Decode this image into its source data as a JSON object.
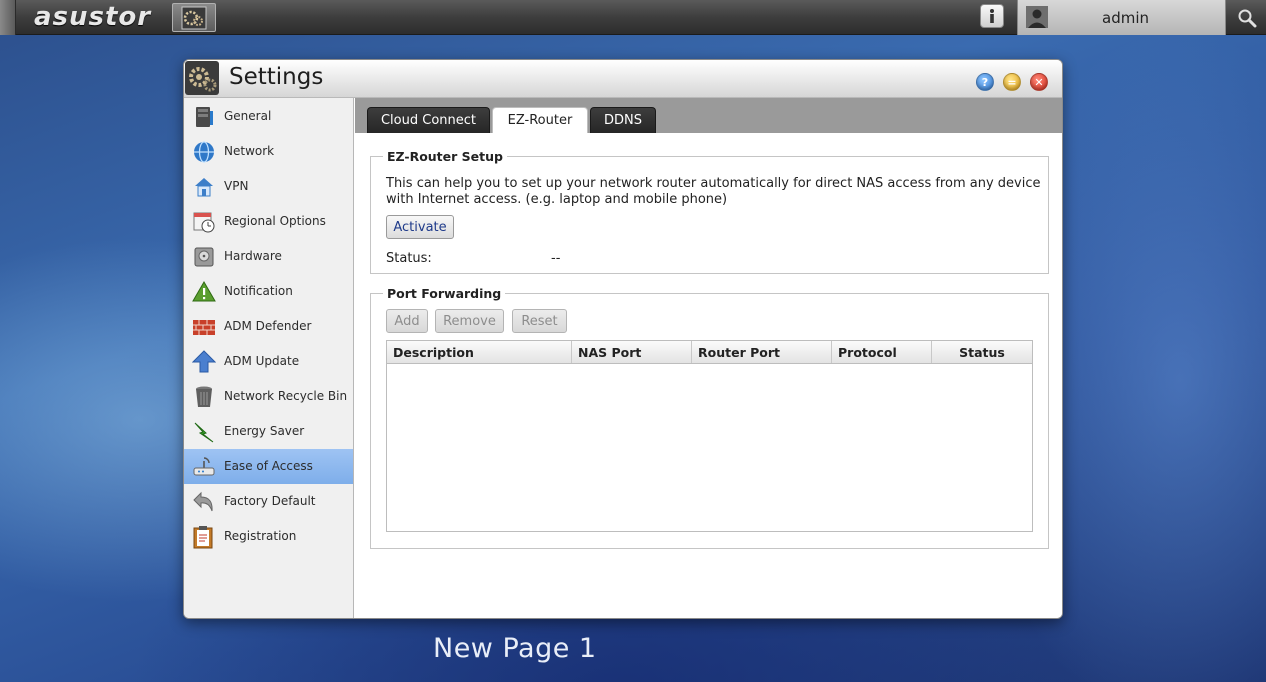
{
  "taskbar": {
    "brand": "asustor",
    "user": "admin"
  },
  "window": {
    "title": "Settings"
  },
  "sidebar": {
    "items": [
      {
        "label": "General",
        "icon": "server-icon"
      },
      {
        "label": "Network",
        "icon": "globe-icon"
      },
      {
        "label": "VPN",
        "icon": "vpn-house-icon"
      },
      {
        "label": "Regional Options",
        "icon": "calendar-clock-icon"
      },
      {
        "label": "Hardware",
        "icon": "harddisk-icon"
      },
      {
        "label": "Notification",
        "icon": "warning-icon"
      },
      {
        "label": "ADM Defender",
        "icon": "firewall-icon"
      },
      {
        "label": "ADM Update",
        "icon": "update-arrow-icon"
      },
      {
        "label": "Network Recycle Bin",
        "icon": "trash-icon"
      },
      {
        "label": "Energy Saver",
        "icon": "energy-icon"
      },
      {
        "label": "Ease of Access",
        "icon": "router-icon"
      },
      {
        "label": "Factory Default",
        "icon": "undo-icon"
      },
      {
        "label": "Registration",
        "icon": "clipboard-icon"
      }
    ],
    "active_index": 10
  },
  "tabs": [
    {
      "label": "Cloud Connect"
    },
    {
      "label": "EZ-Router"
    },
    {
      "label": "DDNS"
    }
  ],
  "active_tab": 1,
  "ez_router": {
    "legend": "EZ-Router Setup",
    "description": "This can help you to set up your network router automatically for direct NAS access from any device with Internet access. (e.g. laptop and mobile phone)",
    "activate_label": "Activate",
    "status_label": "Status:",
    "status_value": "--"
  },
  "port_forwarding": {
    "legend": "Port Forwarding",
    "buttons": {
      "add": "Add",
      "remove": "Remove",
      "reset": "Reset"
    },
    "columns": [
      "Description",
      "NAS Port",
      "Router Port",
      "Protocol",
      "Status"
    ],
    "rows": []
  },
  "page_label": "New Page 1",
  "colors": {
    "active_sidebar": "#8db8ef",
    "link_text": "#1e3a8a"
  }
}
